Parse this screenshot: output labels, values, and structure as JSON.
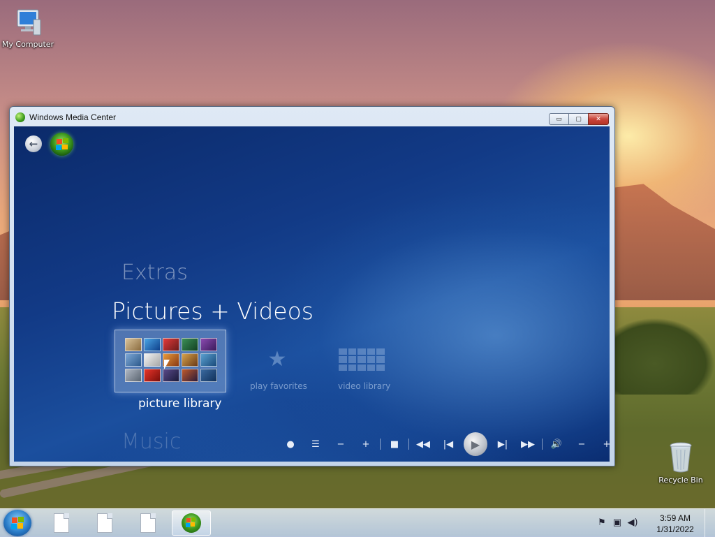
{
  "desktop": {
    "icons": [
      {
        "label": "My Computer"
      },
      {
        "label": "Recycle Bin"
      }
    ]
  },
  "window": {
    "title": "Windows Media Center",
    "controls": {
      "minimize": "▭",
      "maximize": "▢",
      "close": "✕"
    }
  },
  "media_center": {
    "back_icon": "←",
    "categories": {
      "above": "Extras",
      "current": "Pictures + Videos",
      "below": "Music"
    },
    "tiles": [
      {
        "label": "picture library",
        "selected": true
      },
      {
        "label": "play favorites",
        "icon": "star-icon"
      },
      {
        "label": "video library",
        "icon": "grid-icon"
      }
    ],
    "transport": {
      "record": "●",
      "guide": "☰",
      "channel_down": "−",
      "channel_up": "+",
      "stop": "■",
      "rewind": "◀◀",
      "previous": "|◀",
      "play": "▶",
      "next": "▶|",
      "fast_forward": "▶▶",
      "mute": "🔊",
      "volume_down": "−",
      "volume_up": "+"
    }
  },
  "taskbar": {
    "clock_time": "3:59 AM",
    "clock_date": "1/31/2022"
  },
  "colors": {
    "media_center_bg": "#123a86",
    "taskbar": "#c9d9ee"
  }
}
